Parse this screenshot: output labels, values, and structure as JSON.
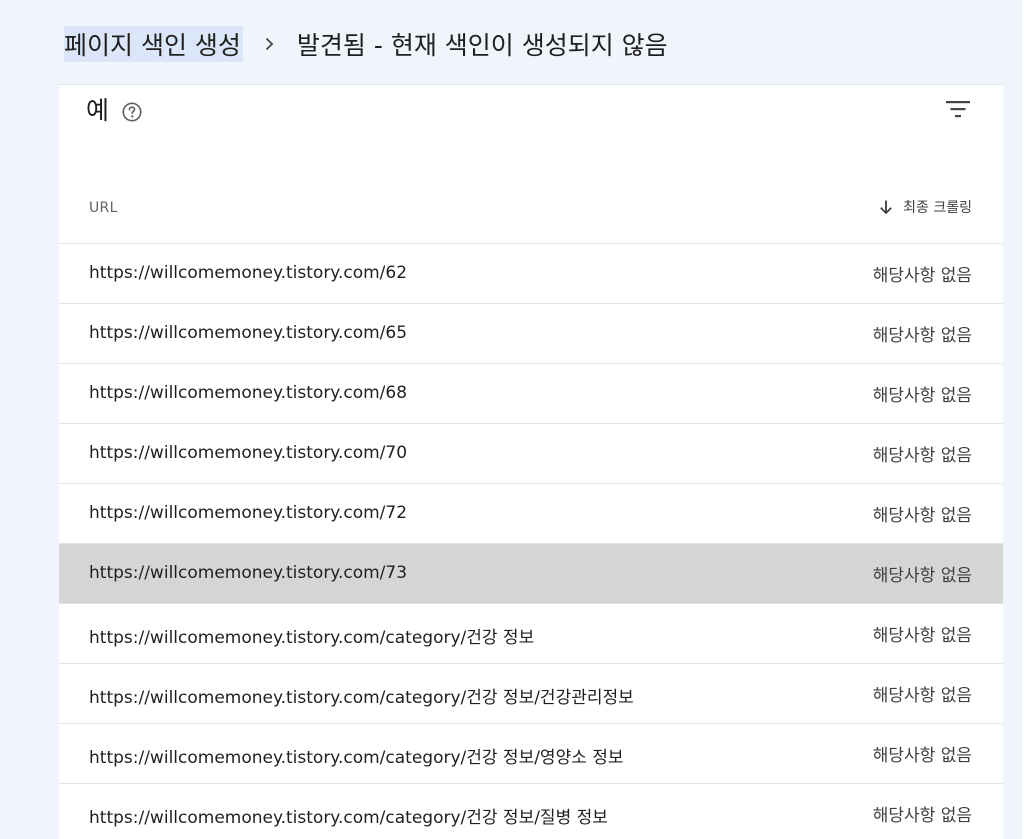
{
  "breadcrumb": {
    "parent": "페이지 색인 생성",
    "current": "발견됨 - 현재 색인이 생성되지 않음"
  },
  "card": {
    "title": "예",
    "icons": {
      "help": "help-circle-icon",
      "filter": "filter-icon",
      "sort": "arrow-down-icon"
    }
  },
  "table": {
    "columns": {
      "url": "URL",
      "last_crawl": "최종 크롤링"
    },
    "rows": [
      {
        "url": "https://willcomemoney.tistory.com/62",
        "last_crawl": "해당사항 없음"
      },
      {
        "url": "https://willcomemoney.tistory.com/65",
        "last_crawl": "해당사항 없음"
      },
      {
        "url": "https://willcomemoney.tistory.com/68",
        "last_crawl": "해당사항 없음"
      },
      {
        "url": "https://willcomemoney.tistory.com/70",
        "last_crawl": "해당사항 없음"
      },
      {
        "url": "https://willcomemoney.tistory.com/72",
        "last_crawl": "해당사항 없음"
      },
      {
        "url": "https://willcomemoney.tistory.com/73",
        "last_crawl": "해당사항 없음"
      },
      {
        "url": "https://willcomemoney.tistory.com/category/건강 정보",
        "last_crawl": "해당사항 없음"
      },
      {
        "url": "https://willcomemoney.tistory.com/category/건강 정보/건강관리정보",
        "last_crawl": "해당사항 없음"
      },
      {
        "url": "https://willcomemoney.tistory.com/category/건강 정보/영양소 정보",
        "last_crawl": "해당사항 없음"
      },
      {
        "url": "https://willcomemoney.tistory.com/category/건강 정보/질병 정보",
        "last_crawl": "해당사항 없음"
      }
    ],
    "selected_index": 5
  }
}
